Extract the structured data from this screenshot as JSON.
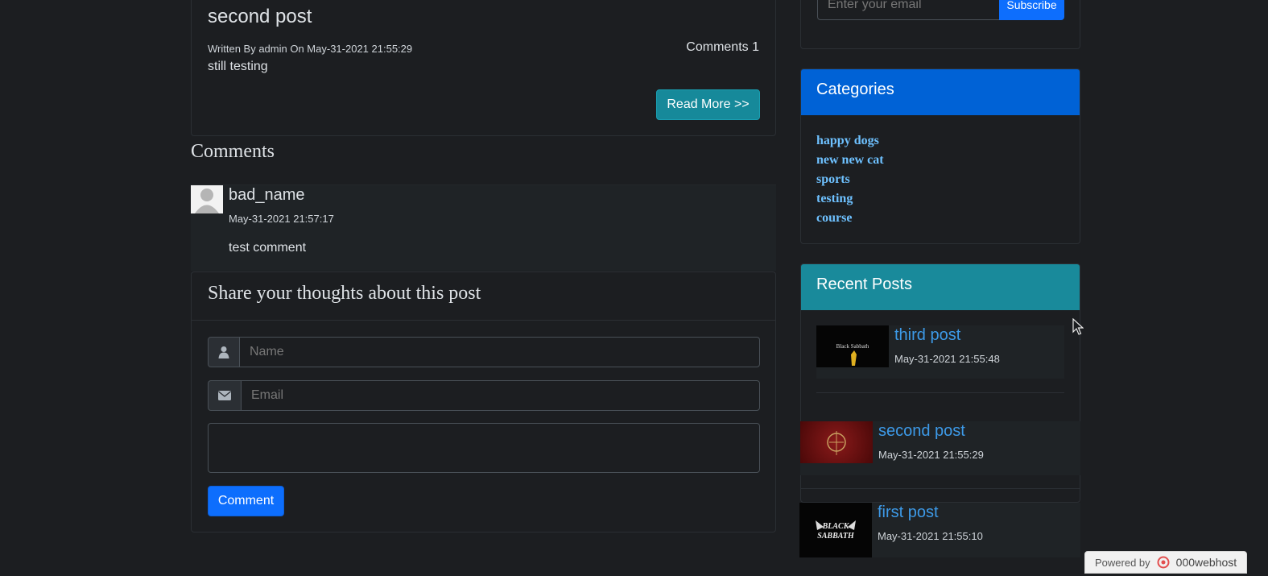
{
  "post": {
    "title": "second post",
    "meta": "Written By admin On May-31-2021 21:55:29",
    "comments_count": "Comments 1",
    "excerpt": "still testing",
    "read_more": "Read More >>"
  },
  "comments": {
    "heading": "Comments",
    "items": [
      {
        "author": "bad_name",
        "date": "May-31-2021 21:57:17",
        "text": "test comment"
      }
    ]
  },
  "comment_form": {
    "heading": "Share your thoughts about this post",
    "name_placeholder": "Name",
    "email_placeholder": "Email",
    "message_value": "",
    "submit_label": "Comment"
  },
  "newsletter": {
    "email_placeholder": "Enter your email",
    "subscribe_label": "Subscribe"
  },
  "categories": {
    "heading": "Categories",
    "items": [
      "happy dogs",
      "new new cat",
      "sports",
      "testing",
      "course"
    ]
  },
  "recent_posts": {
    "heading": "Recent Posts",
    "items": [
      {
        "title": "third post",
        "date": "May-31-2021 21:55:48",
        "thumb": "black-sabbath-album-thumbnail"
      },
      {
        "title": "second post",
        "date": "May-31-2021 21:55:29",
        "thumb": "red-album-cover-thumbnail"
      },
      {
        "title": "first post",
        "date": "May-31-2021 21:55:10",
        "thumb": "black-sabbath-logo-thumbnail"
      }
    ]
  },
  "footer_badge": {
    "powered_by": "Powered by",
    "brand": "000webhost"
  },
  "colors": {
    "page_bg": "#1c1e21",
    "primary": "#0d6efd",
    "categories_header": "#0062d6",
    "recent_header": "#198a9b",
    "read_more": "#16899a",
    "link": "#6ec1ff"
  },
  "icons": [
    "user-icon",
    "envelope-icon",
    "mouse-cursor-icon"
  ]
}
